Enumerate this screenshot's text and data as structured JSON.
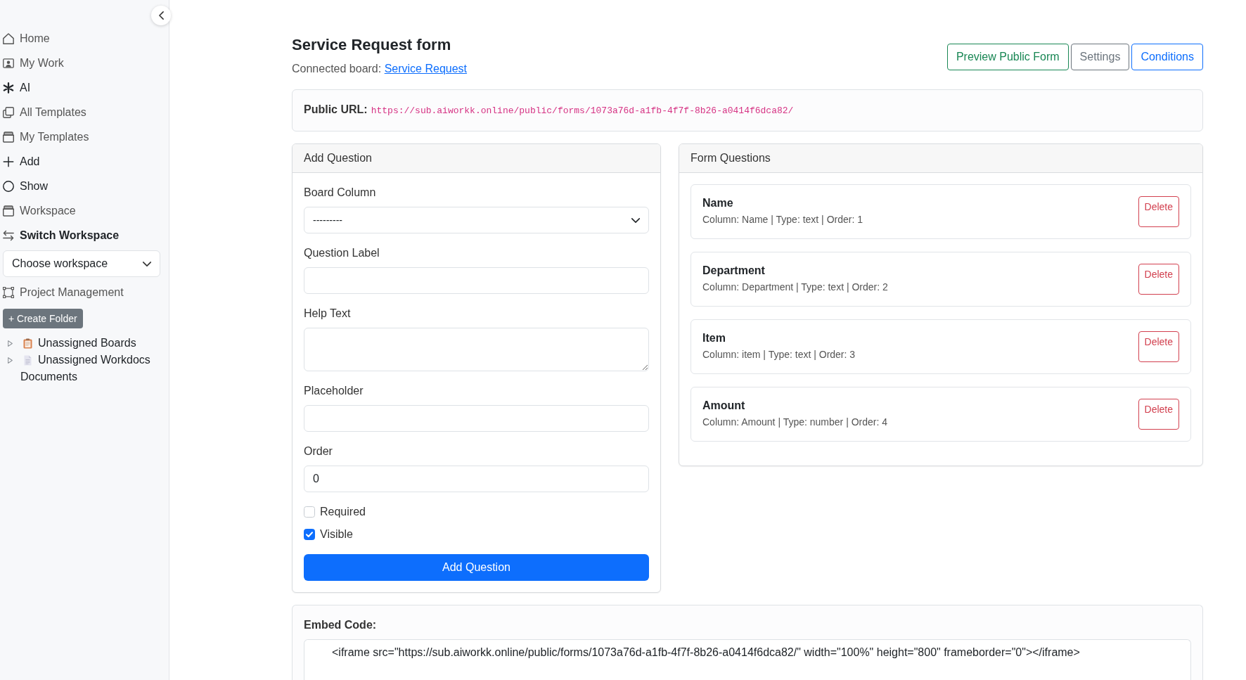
{
  "sidebar": {
    "nav_items": [
      {
        "label": "Home",
        "kind": "link"
      },
      {
        "label": "My Work",
        "kind": "link"
      },
      {
        "label": "AI",
        "kind": "action"
      },
      {
        "label": "All Templates",
        "kind": "link"
      },
      {
        "label": "My Templates",
        "kind": "link"
      },
      {
        "label": "Add",
        "kind": "action"
      },
      {
        "label": "Show",
        "kind": "action"
      },
      {
        "label": "Workspace",
        "kind": "link"
      },
      {
        "label": "Switch Workspace",
        "kind": "heading"
      }
    ],
    "workspace_select": {
      "value": "Choose workspace"
    },
    "project_link": "Project Management",
    "create_folder_button": "+ Create Folder",
    "tree": [
      {
        "label": "Unassigned Boards",
        "expanded": false
      },
      {
        "label": "Unassigned Workdocs",
        "expanded": false
      }
    ],
    "documents_label": "Documents"
  },
  "header": {
    "title": "Service Request form",
    "connected_board_label": "Connected board:",
    "connected_board_link": "Service Request",
    "buttons": [
      {
        "label": "Preview Public Form",
        "kind": "success"
      },
      {
        "label": "Settings",
        "kind": "secondary"
      },
      {
        "label": "Conditions",
        "kind": "primary"
      }
    ]
  },
  "public_url": {
    "label": "Public URL:",
    "url": "https://sub.aiworkk.online/public/forms/1073a76d-a1fb-4f7f-8b26-a0414f6dca82/"
  },
  "add_question": {
    "title": "Add Question",
    "fields": [
      {
        "label": "Board Column",
        "kind": "select",
        "value": "---------"
      },
      {
        "label": "Question Label",
        "kind": "text"
      },
      {
        "label": "Help Text",
        "kind": "textarea"
      },
      {
        "label": "Placeholder",
        "kind": "text"
      },
      {
        "label": "Order",
        "kind": "number",
        "value": "0"
      }
    ],
    "checkboxes": [
      {
        "label": "Required",
        "checked": false
      },
      {
        "label": "Visible",
        "checked": true
      }
    ],
    "submit_button": "Add Question"
  },
  "form_questions": {
    "title": "Form Questions",
    "questions": [
      {
        "title": "Name",
        "details": "Column: Name | Type: text | Order: 1",
        "delete_button": "Delete"
      },
      {
        "title": "Department",
        "details": "Column: Department | Type: text | Order: 2",
        "delete_button": "Delete"
      },
      {
        "title": "Item",
        "details": "Column: item | Type: text | Order: 3",
        "delete_button": "Delete"
      },
      {
        "title": "Amount",
        "details": "Column: Amount | Type: number | Order: 4",
        "delete_button": "Delete"
      }
    ]
  },
  "embed_code": {
    "label": "Embed Code:",
    "code": "<iframe src=\"https://sub.aiworkk.online/public/forms/1073a76d-a1fb-4f7f-8b26-a0414f6dca82/\" width=\"100%\" height=\"800\" frameborder=\"0\"></iframe>"
  }
}
